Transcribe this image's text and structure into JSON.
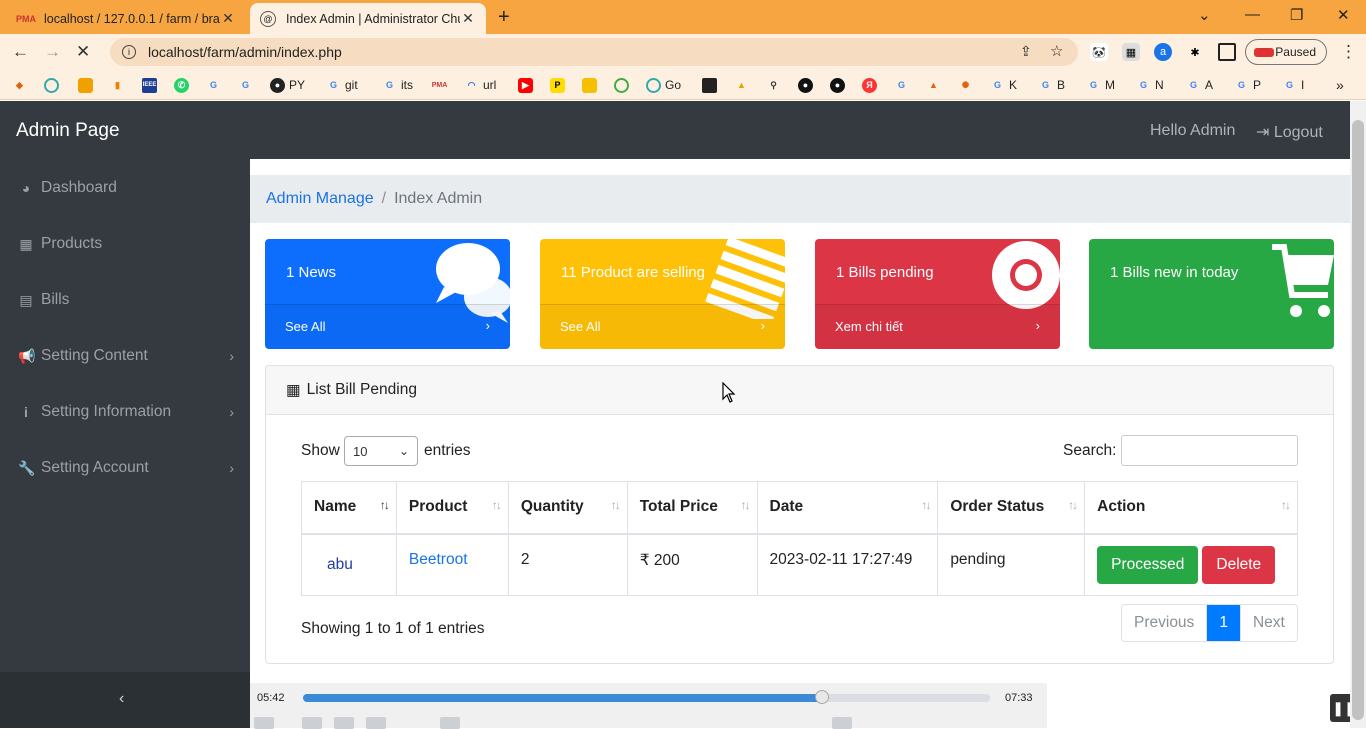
{
  "browser": {
    "tabs": [
      {
        "title": "localhost / 127.0.0.1 / farm / bra",
        "favicon": "PMA"
      },
      {
        "title": "Index Admin | Administrator Chu",
        "favicon": "@"
      }
    ],
    "url": "localhost/farm/admin/index.php",
    "profile_status": "Paused",
    "bookmarks": [
      "PY",
      "git",
      "its",
      "url",
      "Go",
      "K",
      "B",
      "M",
      "N",
      "A",
      "P",
      "I"
    ]
  },
  "app": {
    "brand": "Admin Page",
    "greeting": "Hello Admin",
    "logout": "Logout"
  },
  "sidebar": {
    "items": [
      {
        "label": "Dashboard",
        "icon": "dashboard-icon"
      },
      {
        "label": "Products",
        "icon": "table-icon"
      },
      {
        "label": "Bills",
        "icon": "file-icon"
      },
      {
        "label": "Setting Content",
        "icon": "bullhorn-icon"
      },
      {
        "label": "Setting Information",
        "icon": "info-icon"
      },
      {
        "label": "Setting Account",
        "icon": "wrench-icon"
      }
    ]
  },
  "breadcrumb": {
    "link": "Admin Manage",
    "separator": "/",
    "current": "Index Admin"
  },
  "cards": [
    {
      "text": "1 News",
      "footer": "See All",
      "color": "#0d6efd",
      "icon": "comments-icon"
    },
    {
      "text": "11 Product are selling",
      "footer": "See All",
      "color": "#ffc107",
      "icon": "list-icon"
    },
    {
      "text": "1 Bills pending",
      "footer": "Xem chi tiết",
      "color": "#dc3545",
      "icon": "life-ring-icon"
    },
    {
      "text": "1 Bills new in today",
      "footer": "",
      "color": "#28a745",
      "icon": "cart-icon"
    }
  ],
  "panel": {
    "title": "List Bill Pending",
    "show_label": "Show",
    "entries_value": "10",
    "entries_label": "entries",
    "search_label": "Search:",
    "columns": [
      "Name",
      "Product",
      "Quantity",
      "Total Price",
      "Date",
      "Order Status",
      "Action"
    ],
    "rows": [
      {
        "name": "abu",
        "product": "Beetroot",
        "quantity": "2",
        "total": "₹ 200",
        "date": "2023-02-11 17:27:49",
        "status": "pending"
      }
    ],
    "processed_label": "Processed",
    "delete_label": "Delete",
    "info": "Showing 1 to 1 of 1 entries",
    "pager": {
      "previous": "Previous",
      "current": "1",
      "next": "Next"
    }
  },
  "video": {
    "elapsed": "05:42",
    "total": "07:33",
    "progress": 0.756
  }
}
